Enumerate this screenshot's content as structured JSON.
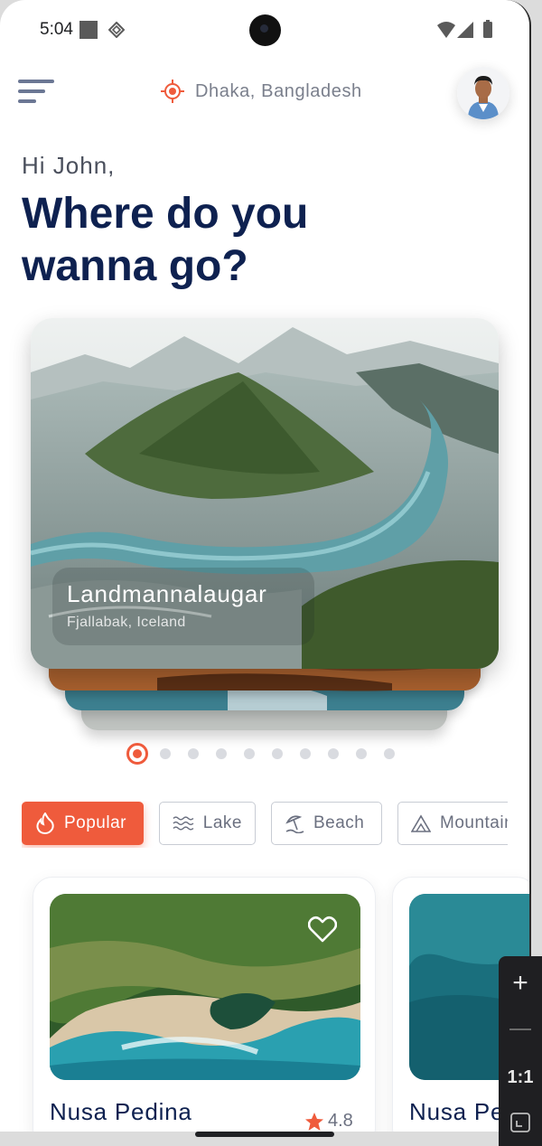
{
  "status_bar": {
    "time": "5:04"
  },
  "header": {
    "location": "Dhaka, Bangladesh",
    "icons": {
      "menu": "menu-icon",
      "location": "location-target-icon",
      "avatar": "user-avatar"
    }
  },
  "greeting": "Hi John,",
  "headline": "Where do you wanna go?",
  "featured": {
    "title": "Landmannalaugar",
    "subtitle": "Fjallabak, Iceland",
    "pages": 10,
    "active_page": 1
  },
  "categories": [
    {
      "label": "Popular",
      "icon": "flame-icon",
      "active": true
    },
    {
      "label": "Lake",
      "icon": "waves-icon",
      "active": false
    },
    {
      "label": "Beach",
      "icon": "beach-umbrella-icon",
      "active": false
    },
    {
      "label": "Mountain",
      "icon": "mountain-icon",
      "active": false
    }
  ],
  "places": [
    {
      "title": "Nusa Pedina",
      "rating": "4.8",
      "favorite_icon": "heart-icon"
    },
    {
      "title": "Nusa Pe",
      "rating": ""
    }
  ],
  "zoom_toolbar": {
    "plus": "+",
    "minus": "−",
    "ratio": "1:1"
  },
  "colors": {
    "accent": "#ef5b3c",
    "heading": "#0e2150",
    "muted": "#7a7f8c"
  }
}
